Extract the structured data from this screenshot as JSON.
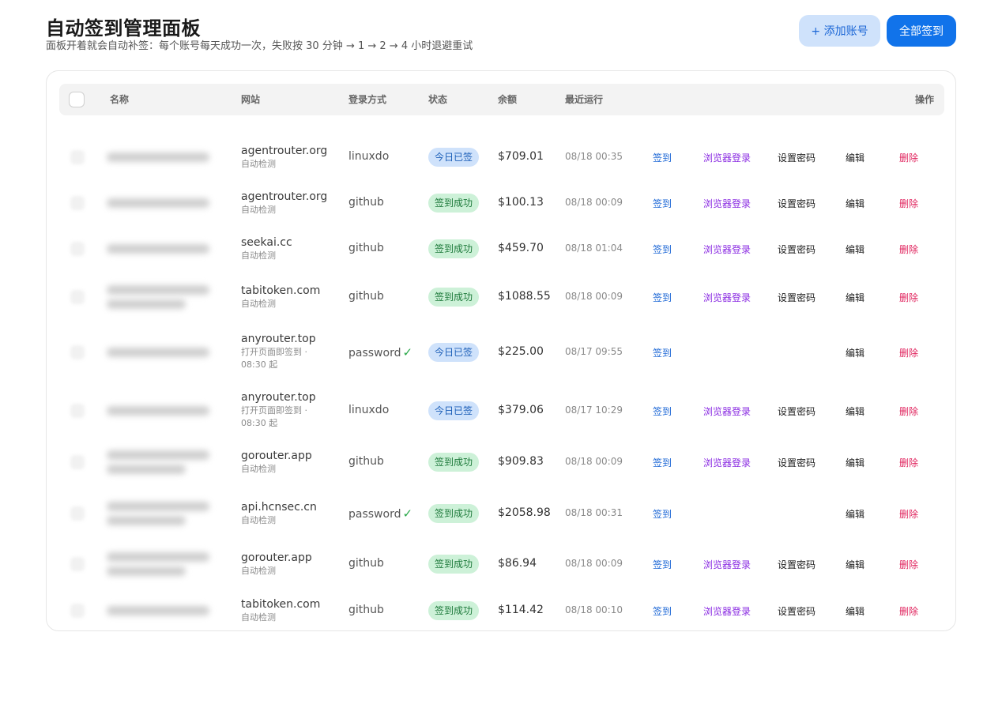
{
  "header": {
    "title": "自动签到管理面板",
    "subtitle": "面板开着就会自动补签：每个账号每天成功一次，失败按 30 分钟 → 1 → 2 → 4 小时退避重试",
    "add_button": "+ 添加账号",
    "all_button": "全部签到"
  },
  "table": {
    "columns": {
      "name": "名称",
      "site": "网站",
      "login": "登录方式",
      "status": "状态",
      "balance": "余额",
      "last_run": "最近运行",
      "actions": "操作"
    },
    "action_labels": {
      "sign": "签到",
      "browser_login": "浏览器登录",
      "set_password": "设置密码",
      "edit": "编辑",
      "delete": "删除"
    },
    "rows": [
      {
        "site": "agentrouter.org",
        "site_sub": "自动检测",
        "login": "linuxdo",
        "verified": false,
        "status": "今日已签",
        "status_type": "today",
        "balance": "$709.01",
        "last_run": "08/18 00:35",
        "has_browser": true
      },
      {
        "site": "agentrouter.org",
        "site_sub": "自动检测",
        "login": "github",
        "verified": false,
        "status": "签到成功",
        "status_type": "ok",
        "balance": "$100.13",
        "last_run": "08/18 00:09",
        "has_browser": true
      },
      {
        "site": "seekai.cc",
        "site_sub": "自动检测",
        "login": "github",
        "verified": false,
        "status": "签到成功",
        "status_type": "ok",
        "balance": "$459.70",
        "last_run": "08/18 01:04",
        "has_browser": true
      },
      {
        "site": "tabitoken.com",
        "site_sub": "自动检测",
        "login": "github",
        "verified": false,
        "status": "签到成功",
        "status_type": "ok",
        "balance": "$1088.55",
        "last_run": "08/18 00:09",
        "has_browser": true
      },
      {
        "site": "anyrouter.top",
        "site_sub": "打开页面即签到 · 08:30 起",
        "login": "password",
        "verified": true,
        "status": "今日已签",
        "status_type": "today",
        "balance": "$225.00",
        "last_run": "08/17 09:55",
        "has_browser": false
      },
      {
        "site": "anyrouter.top",
        "site_sub": "打开页面即签到 · 08:30 起",
        "login": "linuxdo",
        "verified": false,
        "status": "今日已签",
        "status_type": "today",
        "balance": "$379.06",
        "last_run": "08/17 10:29",
        "has_browser": true
      },
      {
        "site": "gorouter.app",
        "site_sub": "自动检测",
        "login": "github",
        "verified": false,
        "status": "签到成功",
        "status_type": "ok",
        "balance": "$909.83",
        "last_run": "08/18 00:09",
        "has_browser": true
      },
      {
        "site": "api.hcnsec.cn",
        "site_sub": "自动检测",
        "login": "password",
        "verified": true,
        "status": "签到成功",
        "status_type": "ok",
        "balance": "$2058.98",
        "last_run": "08/18 00:31",
        "has_browser": false
      },
      {
        "site": "gorouter.app",
        "site_sub": "自动检测",
        "login": "github",
        "verified": false,
        "status": "签到成功",
        "status_type": "ok",
        "balance": "$86.94",
        "last_run": "08/18 00:09",
        "has_browser": true
      },
      {
        "site": "tabitoken.com",
        "site_sub": "自动检测",
        "login": "github",
        "verified": false,
        "status": "签到成功",
        "status_type": "ok",
        "balance": "$114.42",
        "last_run": "08/18 00:10",
        "has_browser": true
      }
    ]
  }
}
